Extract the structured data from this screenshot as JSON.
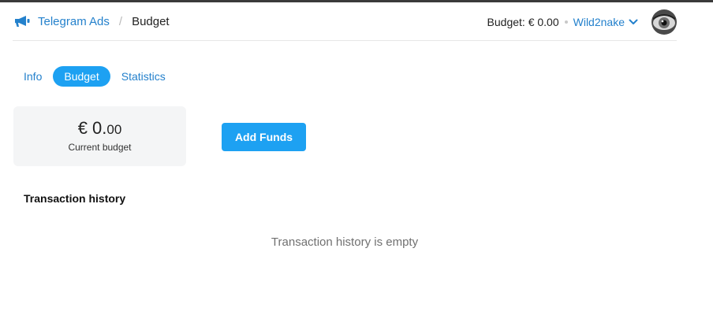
{
  "header": {
    "brand": "Telegram Ads",
    "separator": "/",
    "breadcrumb_current": "Budget",
    "budget_status": "Budget: € 0.00",
    "username": "Wild2nake"
  },
  "tabs": [
    {
      "label": "Info",
      "active": false
    },
    {
      "label": "Budget",
      "active": true
    },
    {
      "label": "Statistics",
      "active": false
    }
  ],
  "budget_card": {
    "amount_main": "€ 0.",
    "amount_cents": "00",
    "caption": "Current budget"
  },
  "add_funds_label": "Add Funds",
  "transactions": {
    "title": "Transaction history",
    "empty_message": "Transaction history is empty"
  },
  "colors": {
    "accent": "#2481cc",
    "button": "#1da1f2",
    "card_bg": "#f4f5f6"
  },
  "icons": [
    "megaphone-icon",
    "chevron-down-icon",
    "avatar"
  ]
}
